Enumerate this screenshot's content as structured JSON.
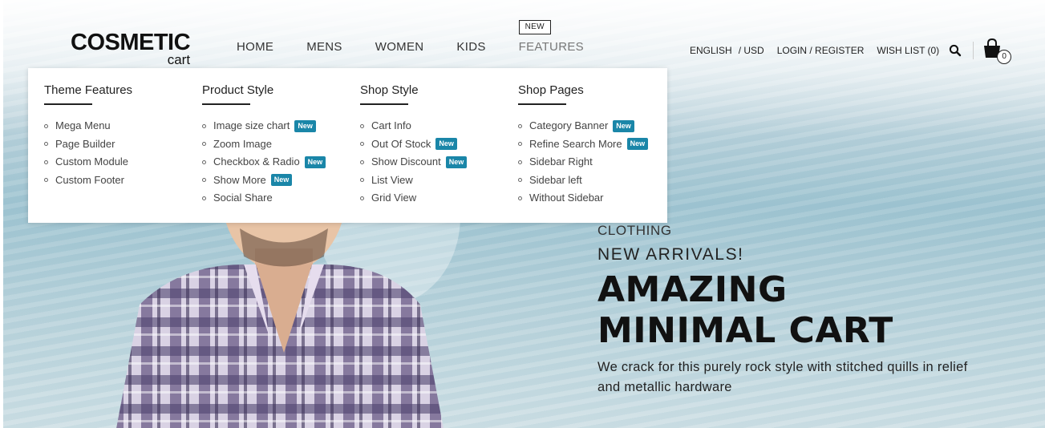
{
  "logo": {
    "main": "COSMETIC",
    "sub": "cart"
  },
  "nav": {
    "items": [
      "HOME",
      "MENS",
      "WOMEN",
      "KIDS",
      "FEATURES"
    ],
    "features_tag": "NEW"
  },
  "topbar": {
    "language": "ENGLISH",
    "currency": "/ USD",
    "login": "LOGIN / REGISTER",
    "wishlist": "WISH LIST (0)",
    "cart_count": "0"
  },
  "mega_menu": {
    "badge_label": "New",
    "columns": [
      {
        "title": "Theme Features",
        "items": [
          {
            "label": "Mega Menu",
            "badge": ""
          },
          {
            "label": "Page Builder",
            "badge": ""
          },
          {
            "label": "Custom Module",
            "badge": ""
          },
          {
            "label": "Custom Footer",
            "badge": ""
          }
        ]
      },
      {
        "title": "Product Style",
        "items": [
          {
            "label": "Image size chart",
            "badge": "New"
          },
          {
            "label": "Zoom Image",
            "badge": ""
          },
          {
            "label": "Checkbox & Radio",
            "badge": "New"
          },
          {
            "label": "Show More",
            "badge": "New"
          },
          {
            "label": "Social Share",
            "badge": ""
          }
        ]
      },
      {
        "title": "Shop Style",
        "items": [
          {
            "label": "Cart Info",
            "badge": ""
          },
          {
            "label": "Out Of Stock",
            "badge": "New"
          },
          {
            "label": "Show Discount",
            "badge": "New"
          },
          {
            "label": "List View",
            "badge": ""
          },
          {
            "label": "Grid View",
            "badge": ""
          }
        ]
      },
      {
        "title": "Shop Pages",
        "items": [
          {
            "label": "Category Banner",
            "badge": "New"
          },
          {
            "label": "Refine Search More",
            "badge": "New"
          },
          {
            "label": "Sidebar Right",
            "badge": ""
          },
          {
            "label": "Sidebar left",
            "badge": ""
          },
          {
            "label": "Without Sidebar",
            "badge": ""
          }
        ]
      }
    ]
  },
  "hero": {
    "eyebrow": "CLOTHING",
    "subtitle": "NEW ARRIVALS!",
    "headline_1": "AMAZING",
    "headline_2": "MINIMAL CART",
    "description": "We crack for this purely rock style with stitched quills in relief and metallic hardware"
  },
  "colors": {
    "badge": "#1a86a8",
    "text": "#222222"
  }
}
